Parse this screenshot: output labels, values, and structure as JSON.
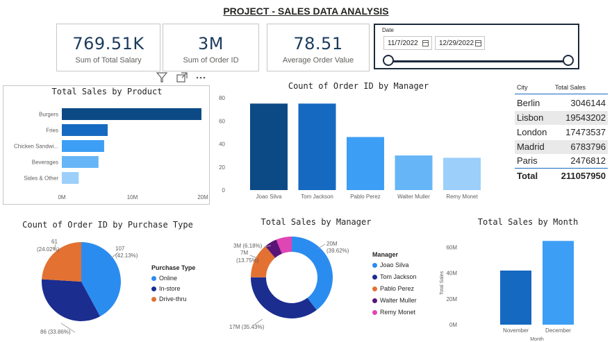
{
  "title": "PROJECT - SALES DATA ANALYSIS",
  "kpis": [
    {
      "value": "769.51K",
      "label": "Sum of Total Salary"
    },
    {
      "value": "3M",
      "label": "Sum of Order ID"
    },
    {
      "value": "78.51",
      "label": "Average Order Value"
    }
  ],
  "date_slicer": {
    "label": "Date",
    "start": "11/7/2022",
    "end": "12/29/2022"
  },
  "visual_header_icons": [
    "filter-icon",
    "focus-mode-icon",
    "more-options-icon"
  ],
  "colors": {
    "dark_blue": "#0c4a85",
    "mid_blue": "#1669c0",
    "blue": "#3d9ef5",
    "light_blue": "#66b5f6",
    "pale_blue": "#9ccffa",
    "navy": "#1b2d8f",
    "orange": "#e27132",
    "purple": "#5a1478",
    "pink": "#e045b4",
    "pie_blue": "#2b8cf0"
  },
  "sales_by_product": {
    "title": "Total Sales by Product",
    "chart_data": {
      "type": "bar",
      "orientation": "horizontal",
      "categories": [
        "Burgers",
        "Fries",
        "Chicken Sandwi...",
        "Beverages",
        "Sides & Other"
      ],
      "values": [
        19.8,
        6.5,
        6.0,
        5.2,
        2.4
      ],
      "unit": "M",
      "xticks": [
        "0M",
        "10M",
        "20M"
      ],
      "xlim": [
        0,
        20
      ]
    }
  },
  "orders_by_manager": {
    "title": "Count of Order ID by Manager",
    "chart_data": {
      "type": "bar",
      "categories": [
        "Joao Silva",
        "Tom Jackson",
        "Pablo Perez",
        "Walter Muller",
        "Remy Monet"
      ],
      "values": [
        75,
        75,
        46,
        30,
        28
      ],
      "yticks": [
        "0",
        "20",
        "40",
        "60",
        "80"
      ],
      "ylim": [
        0,
        80
      ]
    }
  },
  "city_table": {
    "headers": [
      "City",
      "Total Sales"
    ],
    "rows": [
      {
        "city": "Berlin",
        "sales": "3046144"
      },
      {
        "city": "Lisbon",
        "sales": "19543202"
      },
      {
        "city": "London",
        "sales": "17473537"
      },
      {
        "city": "Madrid",
        "sales": "6783796"
      },
      {
        "city": "Paris",
        "sales": "2476812"
      }
    ],
    "total_label": "Total",
    "total_value": "211057950"
  },
  "purchase_type": {
    "title": "Count of Order ID by Purchase Type",
    "legend_title": "Purchase Type",
    "chart_data": {
      "type": "pie",
      "slices": [
        {
          "name": "Online",
          "value": 107,
          "label_value": "107",
          "label_pct": "(42.13%)"
        },
        {
          "name": "In-store",
          "value": 86,
          "label_text": "86 (33.86%)"
        },
        {
          "name": "Drive-thru",
          "value": 61,
          "label_value": "61",
          "label_pct": "(24.02%)"
        }
      ]
    }
  },
  "sales_by_manager": {
    "title": "Total Sales by Manager",
    "legend_title": "Manager",
    "chart_data": {
      "type": "pie",
      "donut": true,
      "slices": [
        {
          "name": "Joao Silva",
          "value": 39.62
        },
        {
          "name": "Tom Jackson",
          "value": 35.43
        },
        {
          "name": "Pablo Perez",
          "value": 13.75
        },
        {
          "name": "Walter Muller",
          "value": 5.0
        },
        {
          "name": "Remy Monet",
          "value": 6.18
        }
      ],
      "labels": {
        "a": "20M",
        "a2": "(39.62%)",
        "b": "17M (35.43%)",
        "c": "7M",
        "c2": "(13.75%)",
        "d": "3M (6.18%)"
      }
    }
  },
  "sales_by_month": {
    "title": "Total Sales by Month",
    "chart_data": {
      "type": "bar",
      "categories": [
        "November",
        "December"
      ],
      "values": [
        42,
        65
      ],
      "unit": "M",
      "yticks": [
        "0M",
        "20M",
        "40M",
        "60M"
      ],
      "ylim": [
        0,
        70
      ],
      "xlabel": "Month",
      "ylabel": "Total Sales"
    }
  }
}
